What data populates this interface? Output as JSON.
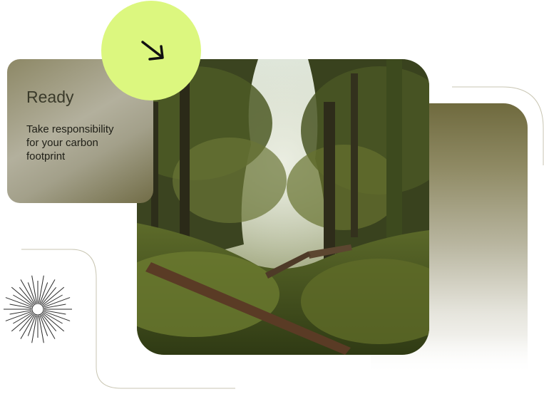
{
  "card": {
    "title": "Ready",
    "text": "Take responsibility for your carbon footprint"
  },
  "colors": {
    "accent": "#dcf77f",
    "olive_dark": "#6f6a3e",
    "card_text": "#1f1f17",
    "line": "#c9c6b3"
  },
  "icons": {
    "action": "arrow-down-right-icon",
    "decoration": "sunburst-icon"
  },
  "image": {
    "subject": "mossy forest with fallen logs"
  }
}
